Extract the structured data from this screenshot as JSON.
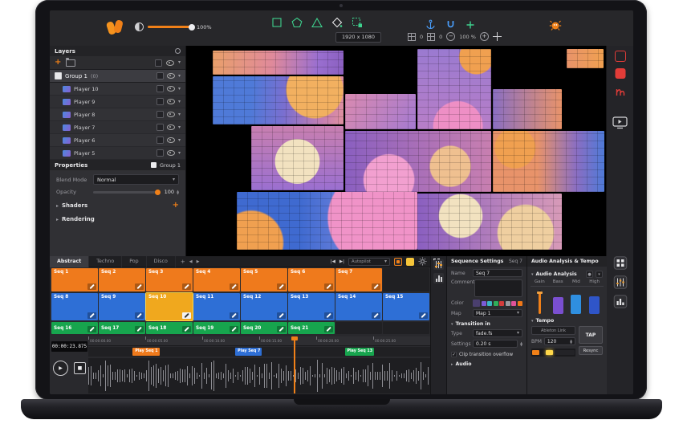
{
  "accent_color": "#f08018",
  "window": {
    "brightness": "100%",
    "resolution": "1920 x 1080",
    "pos_x": "0",
    "pos_y": "0",
    "zoom": "100 %"
  },
  "layers_panel": {
    "title": "Layers",
    "group": {
      "name": "Group 1",
      "badge": "(0)"
    },
    "players": [
      "Player 10",
      "Player 9",
      "Player 8",
      "Player 7",
      "Player 6",
      "Player 5"
    ]
  },
  "properties_panel": {
    "title": "Properties",
    "target": "Group 1",
    "blend_mode_label": "Blend Mode",
    "blend_mode_value": "Normal",
    "opacity_label": "Opacity",
    "opacity_value": "100",
    "sections": [
      "Shaders",
      "Rendering"
    ]
  },
  "sequencer": {
    "tabs": [
      "Abstract",
      "Techno",
      "Pop",
      "Disco"
    ],
    "active_tab": "Abstract",
    "autopilot_label": "Autopilot",
    "rows": [
      {
        "color": "#ef7a1c",
        "cells": [
          "Seq 1",
          "Seq 2",
          "Seq 3",
          "Seq 4",
          "Seq 5",
          "Seq 6",
          "Seq 7"
        ]
      },
      {
        "color": "#2e6fd6",
        "cells": [
          "Seq 8",
          "Seq 9",
          "Seq 10",
          "Seq 11",
          "Seq 12",
          "Seq 13",
          "Seq 14",
          "Seq 15"
        ],
        "active_cell": "Seq 10",
        "active_color": "#f0a81e"
      },
      {
        "color": "#17a54e",
        "cells": [
          "Seq 16",
          "Seq 17",
          "Seq 18",
          "Seq 19",
          "Seq 20",
          "Seq 21"
        ]
      }
    ]
  },
  "timeline": {
    "timecode": "00:00:23.875",
    "ticks": [
      "00:00:00.00",
      "00:00:05.00",
      "00:00:10.00",
      "00:00:15.00",
      "00:00:20.00",
      "00:00:25.00"
    ],
    "clips": [
      {
        "label": "Play Seq 1",
        "color": "#ef7a1c",
        "x_pct": 13
      },
      {
        "label": "Play Seq 7",
        "color": "#2e6fd6",
        "x_pct": 43
      },
      {
        "label": "Play Seq 13",
        "color": "#17a54e",
        "x_pct": 75
      }
    ],
    "playhead_pct": 60
  },
  "sequence_settings": {
    "title": "Sequence Settings",
    "header_value": "Seq 7",
    "name_label": "Name",
    "name_value": "Seq 7",
    "comment_label": "Comment",
    "color_label": "Color",
    "swatches": [
      "#4a3f6e",
      "#7b5bd6",
      "#3bb6c4",
      "#2fae5a",
      "#d43c3c",
      "#9a9aa0",
      "#e0529a",
      "#f07818"
    ],
    "map_label": "Map",
    "map_value": "Map 1",
    "transition_section": "Transition in",
    "type_label": "Type",
    "type_value": "fade.fs",
    "settings_label": "Settings",
    "settings_value": "0.20 s",
    "overflow_label": "Clip transition overflow",
    "audio_section": "Audio"
  },
  "audio_panel": {
    "title": "Audio Analysis & Tempo",
    "analysis_section": "Audio Analysis",
    "meters": [
      {
        "label": "Gain",
        "color": "#f08018",
        "level": 90,
        "thin": true
      },
      {
        "label": "Bass",
        "color": "#7a4fd0",
        "level": 70
      },
      {
        "label": "Mid",
        "color": "#2f8fe0",
        "level": 80
      },
      {
        "label": "High",
        "color": "#2f55c8",
        "level": 72
      }
    ],
    "tempo_section": "Tempo",
    "ableton_label": "Ableton Link",
    "tap_label": "TAP",
    "bpm_label": "BPM",
    "bpm_value": "120",
    "resync_label": "Resync"
  }
}
